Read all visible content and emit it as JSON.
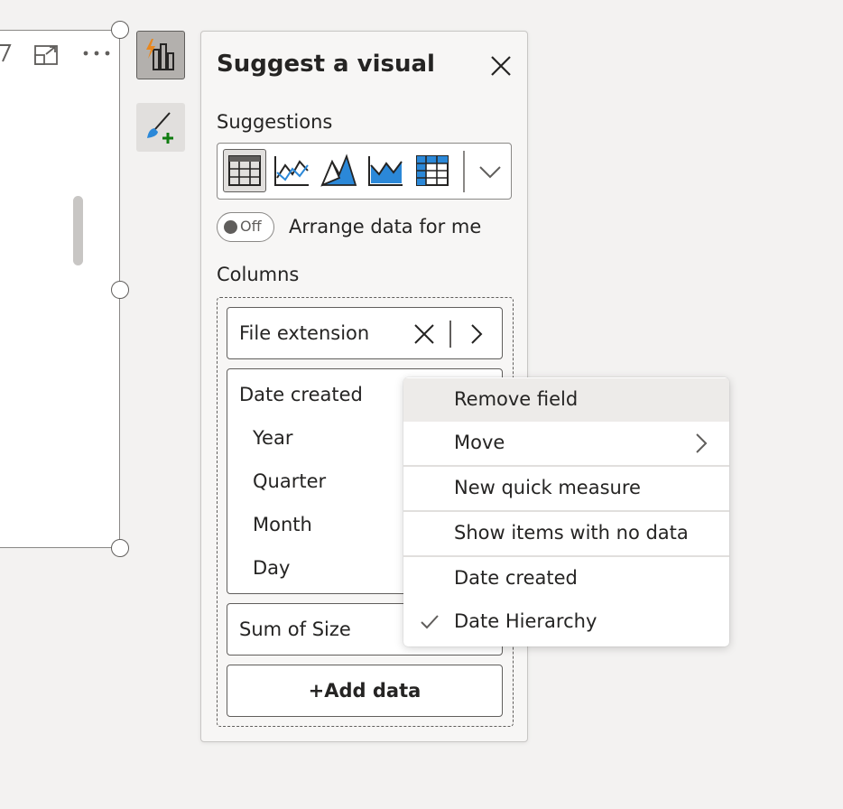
{
  "panel": {
    "title": "Suggest a visual",
    "suggestions_label": "Suggestions",
    "suggestions": [
      {
        "icon": "table-icon",
        "selected": true
      },
      {
        "icon": "line-chart-icon",
        "selected": false
      },
      {
        "icon": "area-chart-icon",
        "selected": false
      },
      {
        "icon": "stacked-area-chart-icon",
        "selected": false
      },
      {
        "icon": "matrix-icon",
        "selected": false
      }
    ],
    "toggle": {
      "state_text": "Off",
      "label": "Arrange data for me"
    },
    "columns_label": "Columns",
    "fields": {
      "file_extension": "File extension",
      "date_created": "Date created",
      "hierarchy": [
        "Year",
        "Quarter",
        "Month",
        "Day"
      ],
      "sum_of_size": "Sum of Size"
    },
    "add_data_label": "+Add data"
  },
  "context_menu": {
    "items": [
      {
        "label": "Remove field"
      },
      {
        "label": "Move"
      },
      {
        "label": "New quick measure"
      },
      {
        "label": "Show items with no data"
      },
      {
        "label": "Date created"
      },
      {
        "label": "Date Hierarchy"
      }
    ]
  },
  "colors": {
    "accent_blue": "#2b88d8",
    "lightning_orange": "#e8871e",
    "add_green": "#107c10",
    "menu_hover": "#edebe9"
  }
}
